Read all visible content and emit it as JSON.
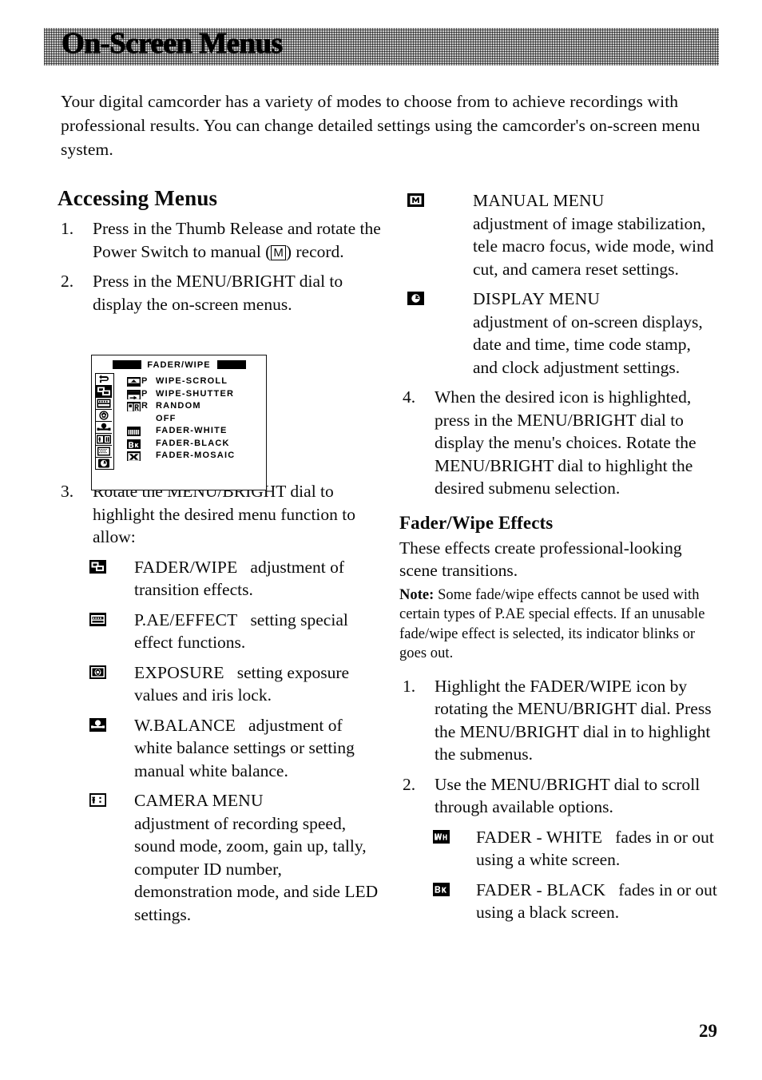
{
  "header": {
    "title": "On-Screen Menus"
  },
  "intro": "Your digital camcorder has a variety of modes to choose from to achieve recordings with professional results. You can change detailed settings using the camcorder's on-screen menu system.",
  "left_column": {
    "section_title": "Accessing Menus",
    "step1_pre": "Press in the Thumb Release and rotate the Power Switch to manual (",
    "step1_glyph": "M",
    "step1_post": ") record.",
    "step1_num": "1.",
    "step2_num": "2.",
    "step2": "Press in the MENU/BRIGHT dial to display the on-screen menus.",
    "step3_num": "3.",
    "step3": "Rotate the MENU/BRIGHT dial to highlight the desired menu function to allow:",
    "menu_items": [
      {
        "icon": "fader-wipe-icon",
        "term": "FADER/WIPE",
        "desc": "adjustment of transition effects."
      },
      {
        "icon": "pae-effect-icon",
        "term": "P.AE/EFFECT",
        "desc": "setting special effect functions."
      },
      {
        "icon": "exposure-icon",
        "term": "EXPOSURE",
        "desc": "setting exposure values and iris lock."
      },
      {
        "icon": "white-balance-icon",
        "term": "W.BALANCE",
        "desc": "adjustment of white balance settings or setting manual white balance."
      },
      {
        "icon": "camera-menu-icon",
        "term": "CAMERA MENU",
        "desc": "adjustment of recording speed, sound mode, zoom, gain up, tally, computer ID number, demonstration mode, and side LED settings."
      }
    ]
  },
  "right_column": {
    "menu_items": [
      {
        "icon": "manual-menu-icon",
        "term": "MANUAL MENU",
        "desc": "adjustment of image stabilization, tele macro focus, wide mode, wind cut, and camera reset settings."
      },
      {
        "icon": "display-menu-icon",
        "term": "DISPLAY MENU",
        "desc": "adjustment of on-screen displays, date and time, time code stamp, and clock adjustment settings."
      }
    ],
    "step4_num": "4.",
    "step4": "When the desired icon is highlighted, press in the MENU/BRIGHT dial to display the menu's choices. Rotate the MENU/BRIGHT dial to highlight the desired submenu selection.",
    "subsection_title": "Fader/Wipe Effects",
    "intro": "These effects create professional-looking scene transitions.",
    "note_label": "Note:",
    "note_text": " Some fade/wipe effects cannot be used with certain types of P.AE special effects. If an unusable fade/wipe effect is selected, its indicator blinks or goes out.",
    "step1_num": "1.",
    "step1": "Highlight the FADER/WIPE icon by rotating the MENU/BRIGHT dial. Press the MENU/BRIGHT dial in to highlight the submenus.",
    "step2_num": "2.",
    "step2": "Use the MENU/BRIGHT dial to scroll through available options.",
    "fader_items": [
      {
        "icon": "fader-white-icon",
        "term": "FADER - WHITE",
        "desc": "fades in or out using a white screen."
      },
      {
        "icon": "fader-black-icon",
        "term": "FADER - BLACK",
        "desc": "fades in or out using a black screen."
      }
    ]
  },
  "lcd_screen": {
    "title": "FADER/WIPE",
    "sidebar_icons": [
      "return-icon",
      "fader-wipe-icon",
      "pae-effect-icon",
      "exposure-icon",
      "white-balance-icon",
      "camera-menu-icon",
      "manual-menu-icon",
      "display-menu-icon"
    ],
    "selected_sidebar_index": 1,
    "rows": [
      {
        "icon": "wipe-scroll-icon",
        "suffix": "P",
        "label": "WIPE-SCROLL"
      },
      {
        "icon": "wipe-shutter-icon",
        "suffix": "P",
        "label": "WIPE-SHUTTER"
      },
      {
        "icon": "random-icon",
        "suffix": "R",
        "label": "RANDOM"
      },
      {
        "icon": "",
        "suffix": "",
        "label": "OFF"
      },
      {
        "icon": "fader-white-icon",
        "suffix": "",
        "label": "FADER-WHITE"
      },
      {
        "icon": "fader-black-icon",
        "suffix": "",
        "label": "FADER-BLACK"
      },
      {
        "icon": "fader-mosaic-icon",
        "suffix": "",
        "label": "FADER-MOSAIC"
      }
    ]
  },
  "folio": "29"
}
